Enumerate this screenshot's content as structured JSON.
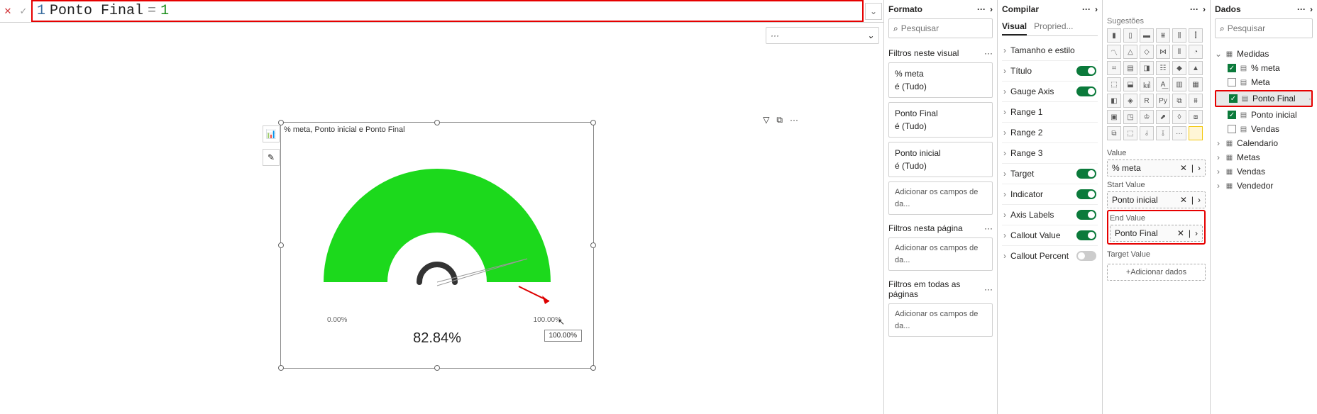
{
  "formula": {
    "line": "1",
    "name": "Ponto Final",
    "eq": "=",
    "value": "1"
  },
  "canvas": {
    "search_ph": "Pesquisar",
    "vis_title": "% meta, Ponto inicial e Ponto Final",
    "gauge": {
      "left_label": "0.00%",
      "right_label": "100.00%",
      "value_label": "82.84%",
      "tooltip": "100.00%"
    }
  },
  "format_pane": {
    "title": "Formato",
    "search_ph": "Pesquisar",
    "filters_visual_label": "Filtros neste visual",
    "filters": [
      {
        "name": "% meta",
        "state": "é (Tudo)"
      },
      {
        "name": "Ponto Final",
        "state": "é (Tudo)"
      },
      {
        "name": "Ponto inicial",
        "state": "é (Tudo)"
      }
    ],
    "add_fields": "Adicionar os campos de da...",
    "filters_page_label": "Filtros nesta página",
    "filters_all_label": "Filtros em todas as páginas"
  },
  "compile_pane": {
    "title": "Compilar",
    "tabs": {
      "visual": "Visual",
      "prop": "Propried..."
    },
    "items": [
      {
        "label": "Tamanho e estilo",
        "toggle": null
      },
      {
        "label": "Título",
        "toggle": true
      },
      {
        "label": "Gauge Axis",
        "toggle": true
      },
      {
        "label": "Range 1",
        "toggle": null
      },
      {
        "label": "Range 2",
        "toggle": null
      },
      {
        "label": "Range 3",
        "toggle": null
      },
      {
        "label": "Target",
        "toggle": true
      },
      {
        "label": "Indicator",
        "toggle": true
      },
      {
        "label": "Axis Labels",
        "toggle": true
      },
      {
        "label": "Callout Value",
        "toggle": true
      },
      {
        "label": "Callout Percent",
        "toggle": false
      }
    ]
  },
  "viz_pane": {
    "title_sugg": "Sugestões",
    "wells": {
      "value_lbl": "Value",
      "value": "% meta",
      "start_lbl": "Start Value",
      "start": "Ponto inicial",
      "end_lbl": "End Value",
      "end": "Ponto Final",
      "target_lbl": "Target Value",
      "add": "+Adicionar dados"
    }
  },
  "data_pane": {
    "title": "Dados",
    "search_ph": "Pesquisar",
    "tables": {
      "medidas": "Medidas",
      "meta": "% meta",
      "meta2": "Meta",
      "pfinal": "Ponto Final",
      "pini": "Ponto inicial",
      "vendas_m": "Vendas",
      "calendario": "Calendario",
      "metas": "Metas",
      "vendas": "Vendas",
      "vendedor": "Vendedor"
    }
  },
  "chart_data": {
    "type": "gauge",
    "min": 0,
    "max": 100,
    "value": 82.84,
    "unit": "%",
    "title": "% meta, Ponto inicial e Ponto Final",
    "range_color": "#1cd91c"
  }
}
